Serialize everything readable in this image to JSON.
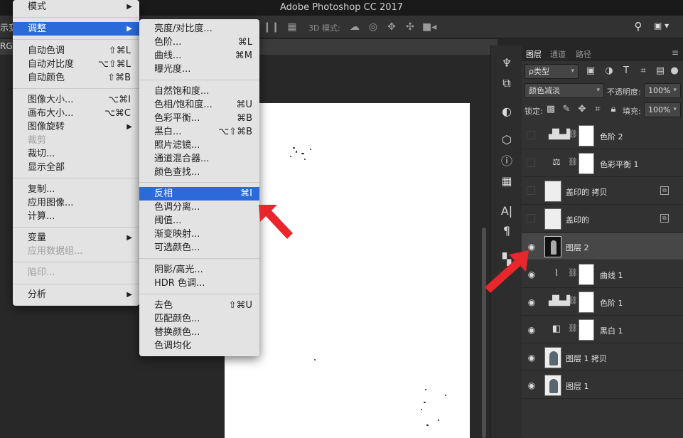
{
  "app": {
    "title": "Adobe Photoshop CC 2017"
  },
  "options_bar": {
    "left_text": "示变",
    "label_3d": "3D 模式:"
  },
  "doc_tab": {
    "mode": "RGB"
  },
  "image_menu": {
    "items": [
      {
        "label": "模式",
        "shortcut": "",
        "submenu": true,
        "state": "normal"
      },
      {
        "label": "调整",
        "shortcut": "",
        "submenu": true,
        "state": "highlighted"
      },
      {
        "label": "自动色调",
        "shortcut": "⇧⌘L",
        "submenu": false,
        "state": "normal"
      },
      {
        "label": "自动对比度",
        "shortcut": "⌥⇧⌘L",
        "submenu": false,
        "state": "normal"
      },
      {
        "label": "自动颜色",
        "shortcut": "⇧⌘B",
        "submenu": false,
        "state": "normal"
      },
      {
        "label": "图像大小...",
        "shortcut": "⌥⌘I",
        "submenu": false,
        "state": "normal"
      },
      {
        "label": "画布大小...",
        "shortcut": "⌥⌘C",
        "submenu": false,
        "state": "normal"
      },
      {
        "label": "图像旋转",
        "shortcut": "",
        "submenu": true,
        "state": "normal"
      },
      {
        "label": "裁剪",
        "shortcut": "",
        "submenu": false,
        "state": "disabled"
      },
      {
        "label": "裁切...",
        "shortcut": "",
        "submenu": false,
        "state": "normal"
      },
      {
        "label": "显示全部",
        "shortcut": "",
        "submenu": false,
        "state": "normal"
      },
      {
        "label": "复制...",
        "shortcut": "",
        "submenu": false,
        "state": "normal"
      },
      {
        "label": "应用图像...",
        "shortcut": "",
        "submenu": false,
        "state": "normal"
      },
      {
        "label": "计算...",
        "shortcut": "",
        "submenu": false,
        "state": "normal"
      },
      {
        "label": "变量",
        "shortcut": "",
        "submenu": true,
        "state": "normal"
      },
      {
        "label": "应用数据组...",
        "shortcut": "",
        "submenu": false,
        "state": "disabled"
      },
      {
        "label": "陷印...",
        "shortcut": "",
        "submenu": false,
        "state": "disabled"
      },
      {
        "label": "分析",
        "shortcut": "",
        "submenu": true,
        "state": "normal"
      }
    ]
  },
  "adjust_menu": {
    "items": [
      {
        "label": "亮度/对比度...",
        "shortcut": "",
        "state": "normal"
      },
      {
        "label": "色阶...",
        "shortcut": "⌘L",
        "state": "normal"
      },
      {
        "label": "曲线...",
        "shortcut": "⌘M",
        "state": "normal"
      },
      {
        "label": "曝光度...",
        "shortcut": "",
        "state": "normal"
      },
      {
        "label": "自然饱和度...",
        "shortcut": "",
        "state": "normal"
      },
      {
        "label": "色相/饱和度...",
        "shortcut": "⌘U",
        "state": "normal"
      },
      {
        "label": "色彩平衡...",
        "shortcut": "⌘B",
        "state": "normal"
      },
      {
        "label": "黑白...",
        "shortcut": "⌥⇧⌘B",
        "state": "normal"
      },
      {
        "label": "照片滤镜...",
        "shortcut": "",
        "state": "normal"
      },
      {
        "label": "通道混合器...",
        "shortcut": "",
        "state": "normal"
      },
      {
        "label": "颜色查找...",
        "shortcut": "",
        "state": "normal"
      },
      {
        "label": "反相",
        "shortcut": "⌘I",
        "state": "highlighted"
      },
      {
        "label": "色调分离...",
        "shortcut": "",
        "state": "normal"
      },
      {
        "label": "阈值...",
        "shortcut": "",
        "state": "normal"
      },
      {
        "label": "渐变映射...",
        "shortcut": "",
        "state": "normal"
      },
      {
        "label": "可选颜色...",
        "shortcut": "",
        "state": "normal"
      },
      {
        "label": "阴影/高光...",
        "shortcut": "",
        "state": "normal"
      },
      {
        "label": "HDR 色调...",
        "shortcut": "",
        "state": "normal"
      },
      {
        "label": "去色",
        "shortcut": "⇧⌘U",
        "state": "normal"
      },
      {
        "label": "匹配颜色...",
        "shortcut": "",
        "state": "normal"
      },
      {
        "label": "替换颜色...",
        "shortcut": "",
        "state": "normal"
      },
      {
        "label": "色调均化",
        "shortcut": "",
        "state": "normal"
      }
    ]
  },
  "layers_panel": {
    "tabs": [
      "图层",
      "通道",
      "路径"
    ],
    "filter_kind": "ρ类型",
    "blend_mode": "颜色减淡",
    "opacity_label": "不透明度:",
    "opacity_value": "100%",
    "lock_label": "锁定:",
    "fill_label": "填充:",
    "fill_value": "100%",
    "layers": [
      {
        "name": "色阶 2",
        "kind": "levels",
        "visible": false,
        "selected": false
      },
      {
        "name": "色彩平衡 1",
        "kind": "balance",
        "visible": false,
        "selected": false
      },
      {
        "name": "盖印的 拷贝",
        "kind": "sketch",
        "visible": false,
        "selected": false
      },
      {
        "name": "盖印的",
        "kind": "sketch",
        "visible": false,
        "selected": false
      },
      {
        "name": "图层 2",
        "kind": "dark",
        "visible": true,
        "selected": true
      },
      {
        "name": "曲线 1",
        "kind": "curves",
        "visible": true,
        "selected": false
      },
      {
        "name": "色阶 1",
        "kind": "levels",
        "visible": true,
        "selected": false
      },
      {
        "name": "黑白 1",
        "kind": "bw",
        "visible": true,
        "selected": false
      },
      {
        "name": "图层 1 拷贝",
        "kind": "photo",
        "visible": true,
        "selected": false
      },
      {
        "name": "图层 1",
        "kind": "photo",
        "visible": true,
        "selected": false
      }
    ]
  },
  "colors": {
    "highlight": "#2c6ad9",
    "annotation_arrow": "#e8262b"
  }
}
